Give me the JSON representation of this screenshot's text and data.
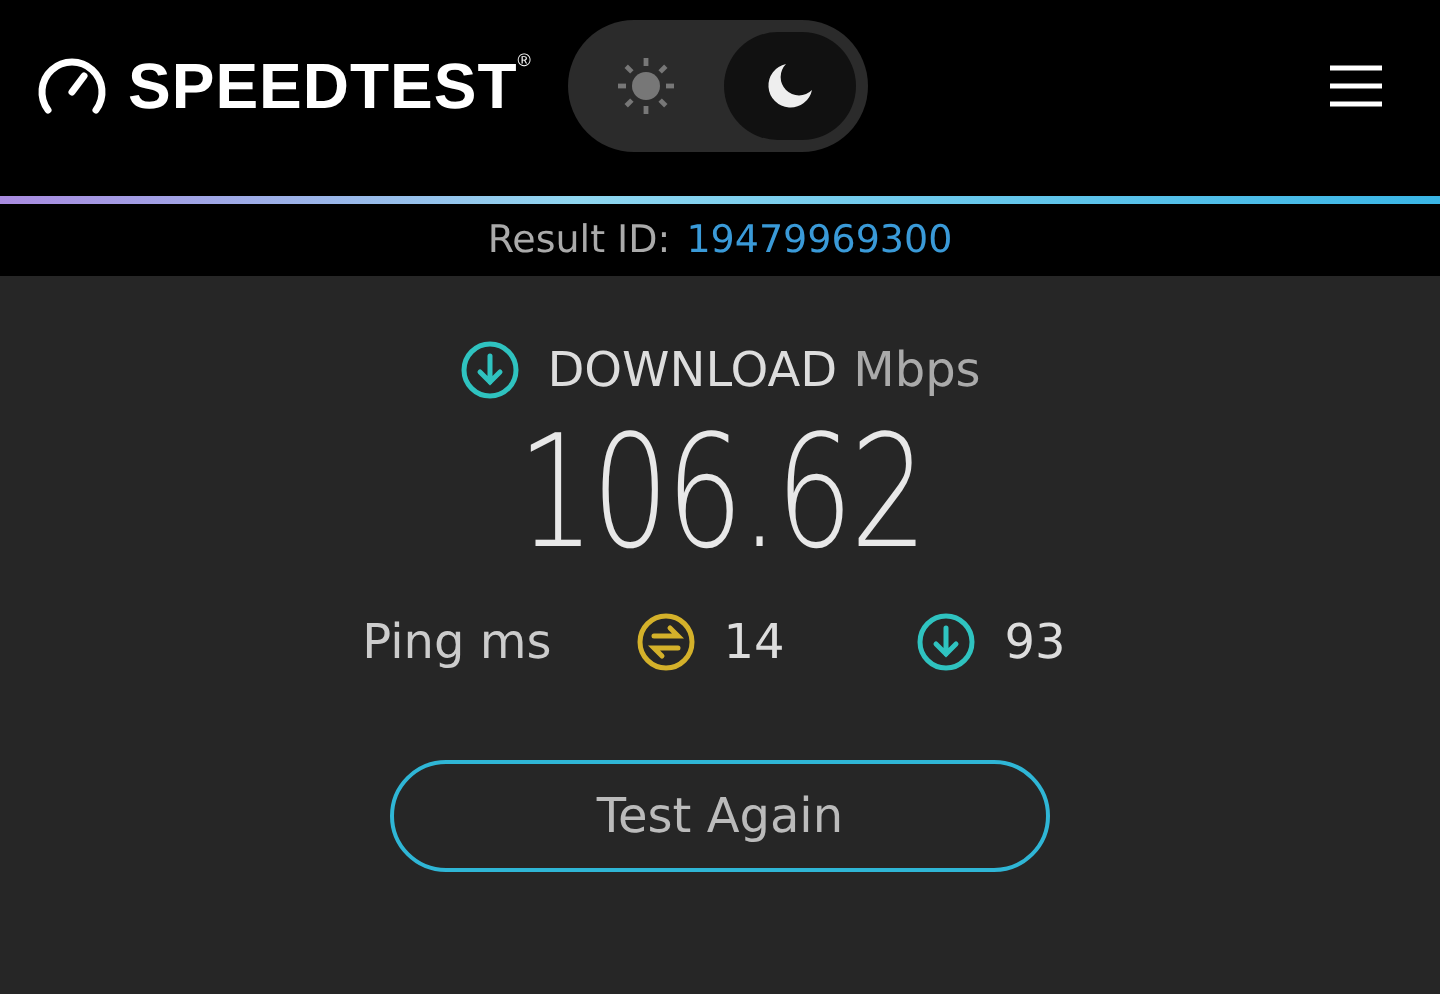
{
  "header": {
    "logo": "SPEEDTEST$^{®}$",
    "theme_toggle": [
      {
        "kind": "light",
        "selected": false
      },
      {
        "kind": "dark",
        "selected": true
      }
    ]
  },
  "result": {
    "label": "Result ID:",
    "id": "19479969300"
  },
  "download": {
    "label": "DOWNLOAD",
    "unit": "Mbps",
    "value": "106.62"
  },
  "ping": {
    "label": "Ping ms",
    "metrics": [
      {
        "kind": "idle",
        "value": "14",
        "color": "#d4b12a"
      },
      {
        "kind": "download",
        "value": "93",
        "color": "#2fc3c0"
      }
    ]
  },
  "button": "Test Again"
}
